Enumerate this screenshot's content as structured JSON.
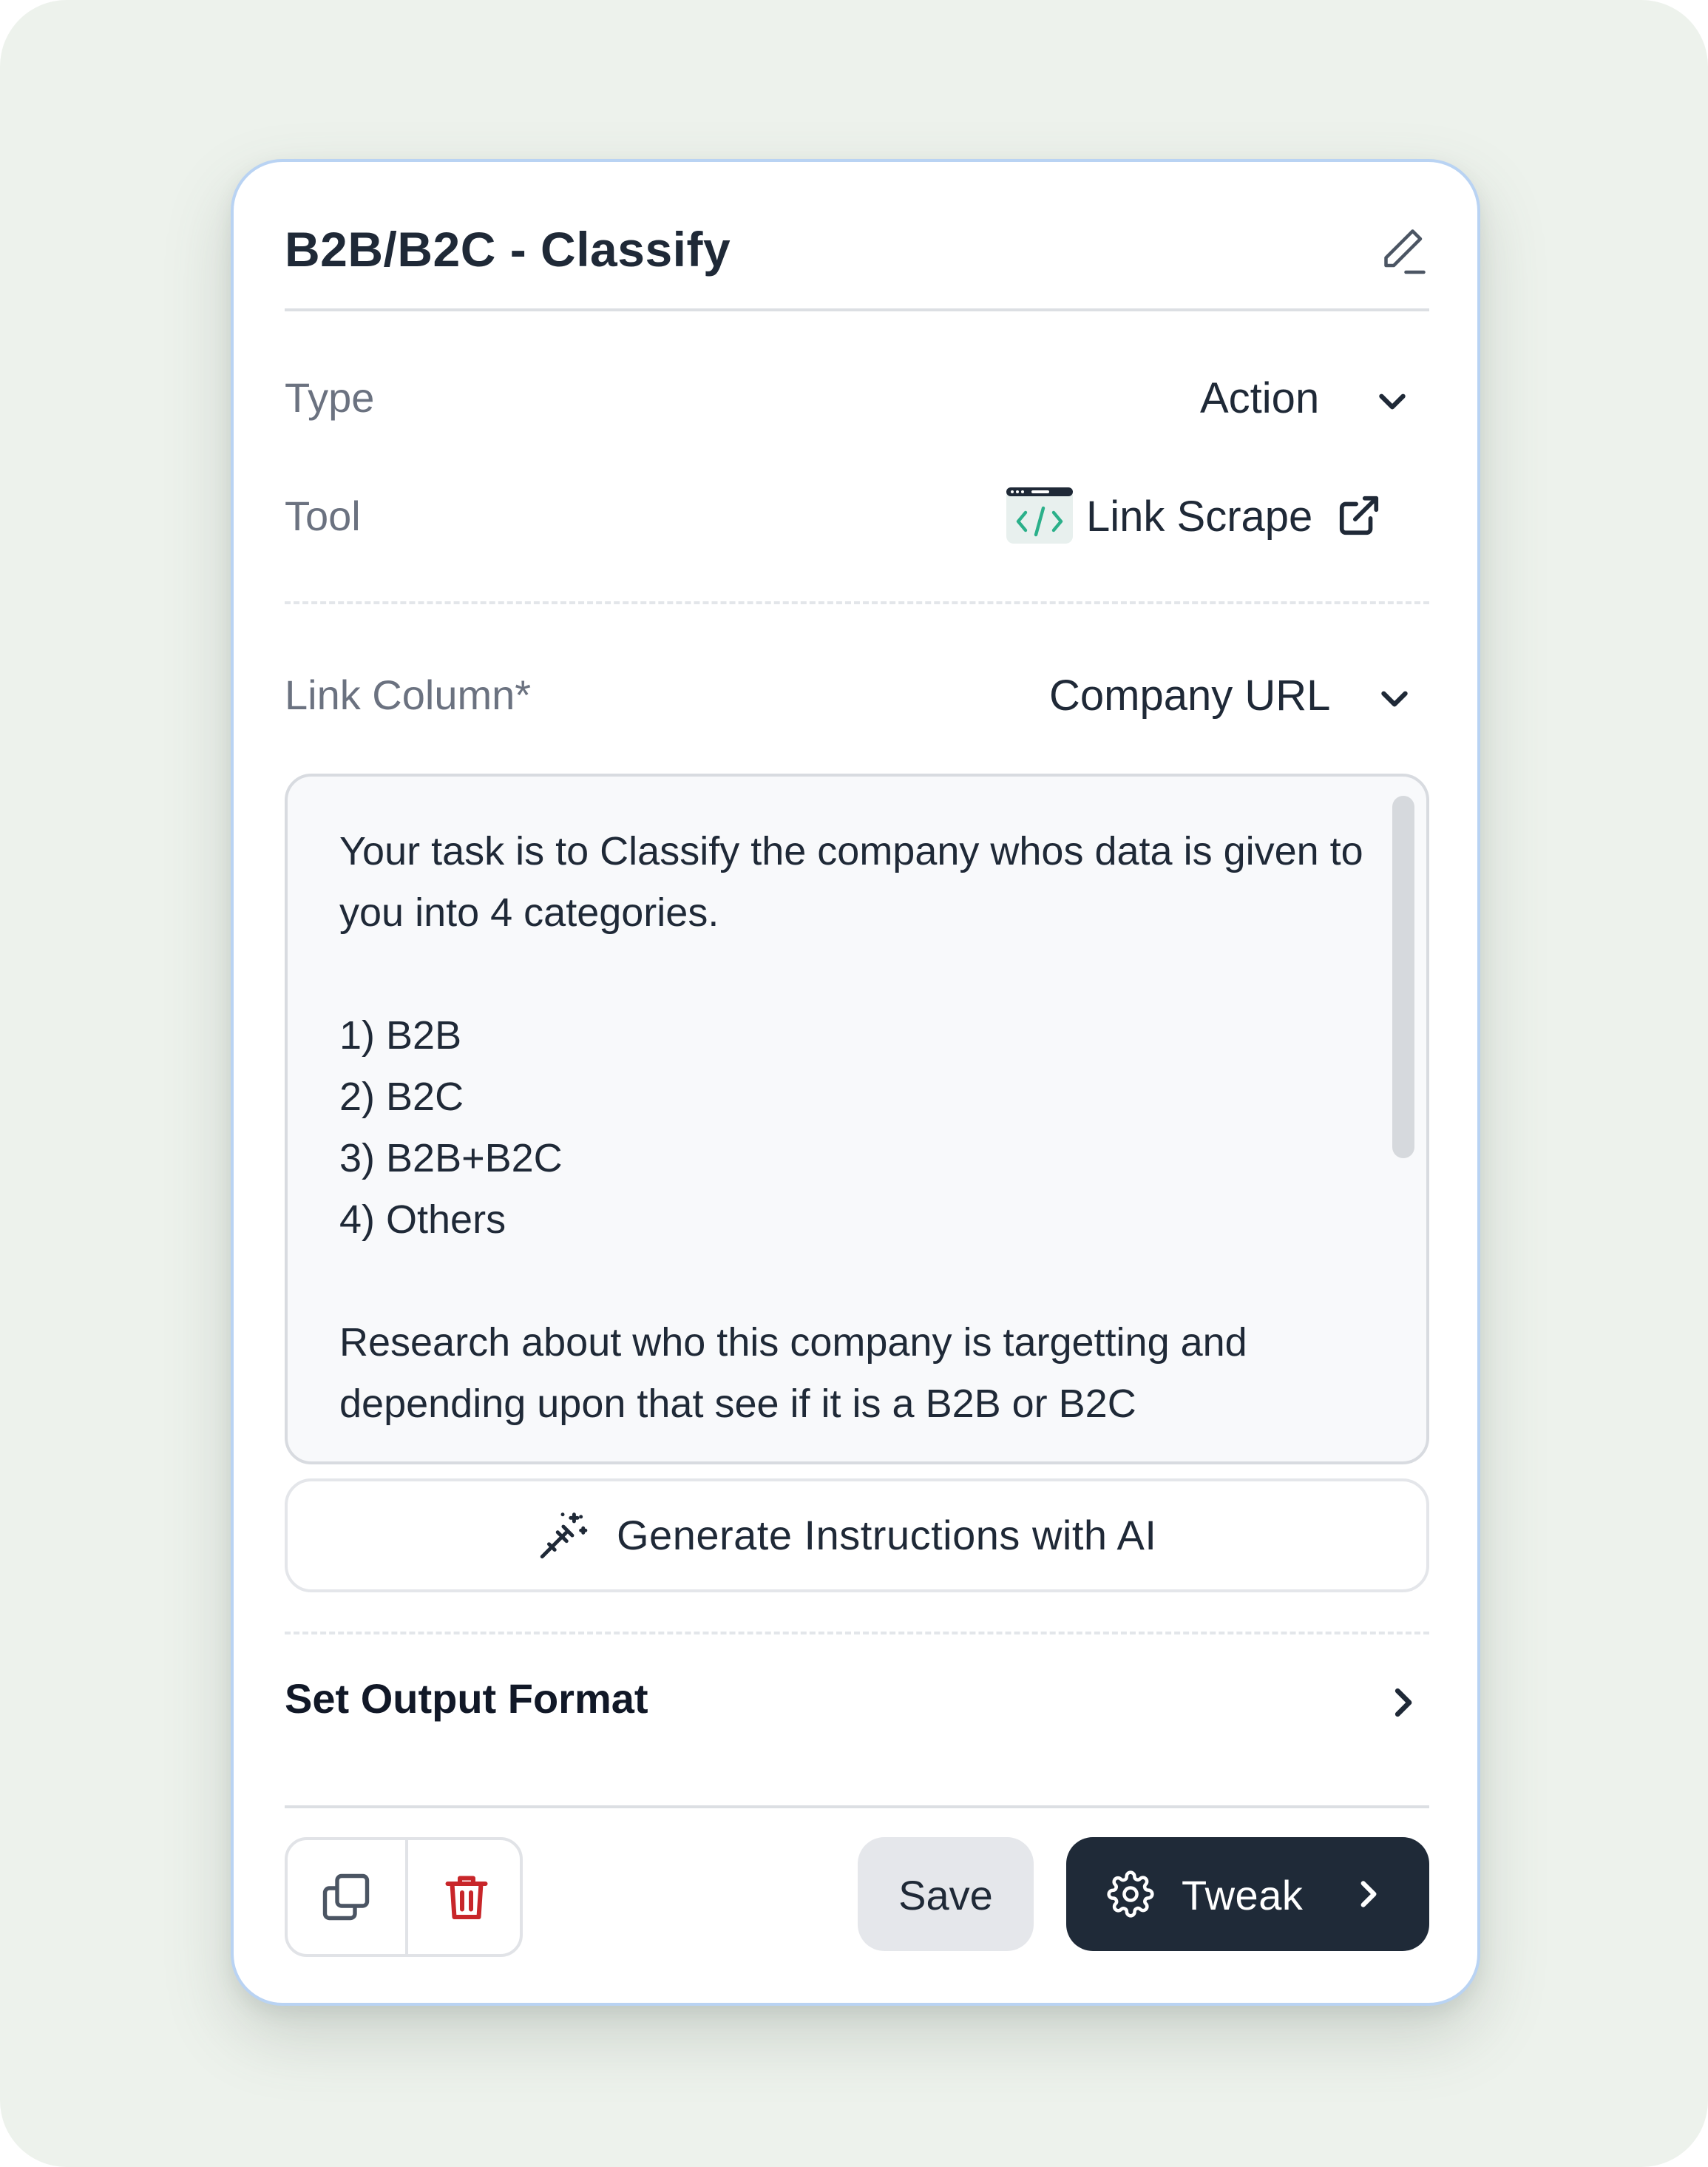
{
  "panel": {
    "title": "B2B/B2C - Classify",
    "icons": {
      "edit": "edit-pencil-icon"
    }
  },
  "fields": {
    "type": {
      "label": "Type",
      "value": "Action",
      "icon": "chevron-down-icon"
    },
    "tool": {
      "label": "Tool",
      "value": "Link Scrape",
      "icon": "code-window-icon",
      "action_icon": "external-link-icon"
    },
    "link_column": {
      "label": "Link Column*",
      "value": "Company URL",
      "icon": "chevron-down-icon"
    }
  },
  "instructions": {
    "text": "Your task is to Classify the company whos data is given to you into 4 categories.\n\n1) B2B\n2) B2C\n3) B2B+B2C\n4) Others\n\nResearch about who this company is targetting and depending upon that see if it is a B2B or B2C"
  },
  "generate_button": {
    "label": "Generate Instructions with AI",
    "icon": "magic-wand-icon"
  },
  "output_format": {
    "label": "Set Output Format",
    "icon": "chevron-right-icon"
  },
  "footer": {
    "duplicate_icon": "duplicate-icon",
    "delete_icon": "trash-icon",
    "save_label": "Save",
    "tweak_label": "Tweak",
    "tweak_icon": "gear-icon"
  },
  "colors": {
    "background": "#edf2ec",
    "card_border": "#b9d3f3",
    "primary_button": "#1f2a38",
    "delete_red": "#c8262a",
    "code_green": "#2bb08a"
  }
}
